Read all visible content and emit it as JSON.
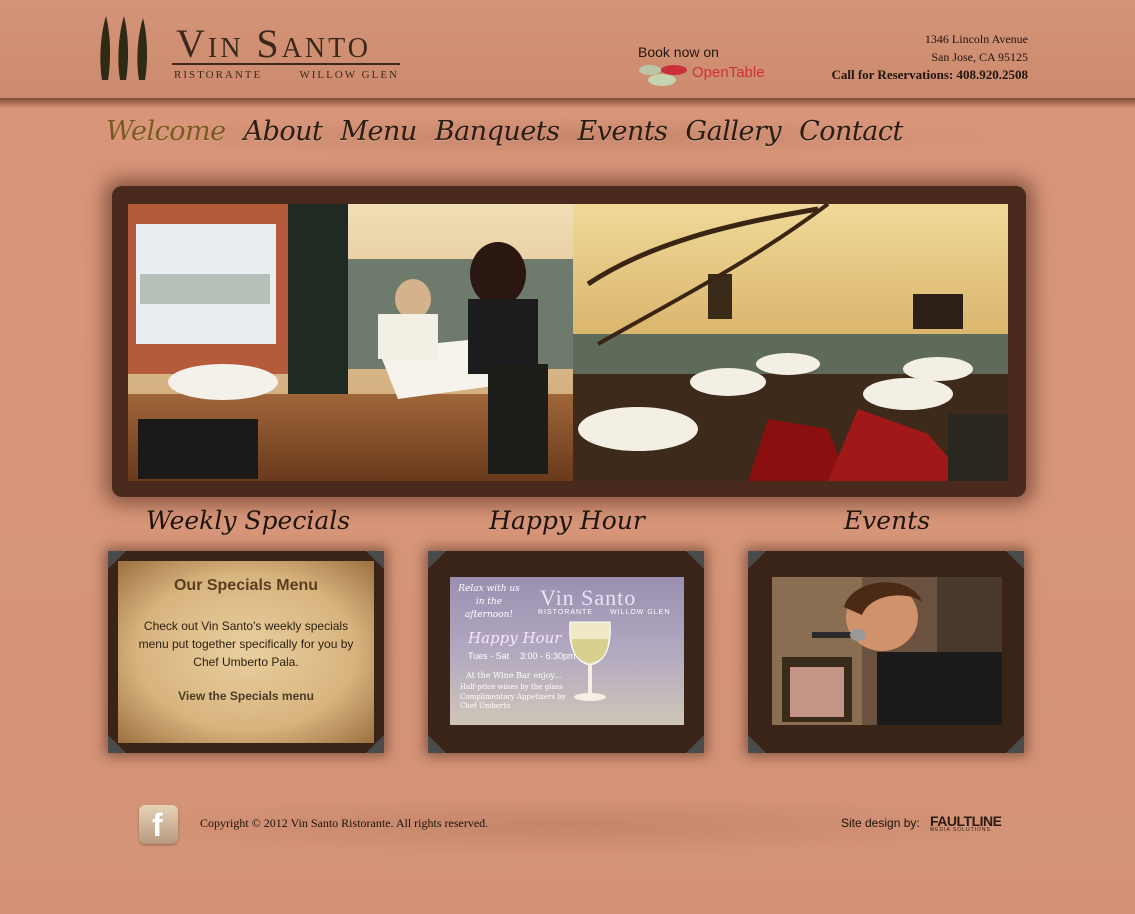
{
  "header": {
    "logo": {
      "name": "Vin Santo",
      "left": "Ristorante",
      "right": "Willow Glen"
    },
    "book_now": "Book now on",
    "opentable": "OpenTable",
    "address_line1": "1346 Lincoln Avenue",
    "address_line2": "San Jose, CA 95125",
    "reservations": "Call for Reservations: 408.920.2508"
  },
  "nav": {
    "items": [
      {
        "label": "Welcome",
        "active": true
      },
      {
        "label": "About"
      },
      {
        "label": "Menu"
      },
      {
        "label": "Banquets"
      },
      {
        "label": "Events"
      },
      {
        "label": "Gallery"
      },
      {
        "label": "Contact"
      }
    ]
  },
  "sections": {
    "specials": {
      "title": "Weekly Specials",
      "heading": "Our Specials Menu",
      "body": "Check out Vin Santo's weekly specials menu put together specifically for you by Chef Umberto Pala.",
      "link": "View the Specials menu"
    },
    "happy_hour": {
      "title": "Happy Hour",
      "tagline": "Relax with us in the afternoon!",
      "brand": "Vin Santo",
      "brand_left": "Ristorante",
      "brand_right": "Willow Glen",
      "happy": "Happy Hour",
      "days": "Tues - Sat",
      "hours": "3:00 - 6:30pm",
      "wine_bar": "At the Wine Bar enjoy...",
      "item1": "Half-price wines by the glass",
      "item2": "Complimentary Appetizers by Chef Umberto"
    },
    "events": {
      "title": "Events"
    }
  },
  "footer": {
    "facebook": "f",
    "copyright": "Copyright © 2012 Vin Santo Ristorante. All rights reserved.",
    "design_by": "Site design by:",
    "designer": "FAULTLINE",
    "designer_sub": "MEDIA SOLUTIONS"
  },
  "colors": {
    "background": "#d6957a",
    "nav_active": "#7a5a1e",
    "opentable_red": "#d0313a"
  }
}
